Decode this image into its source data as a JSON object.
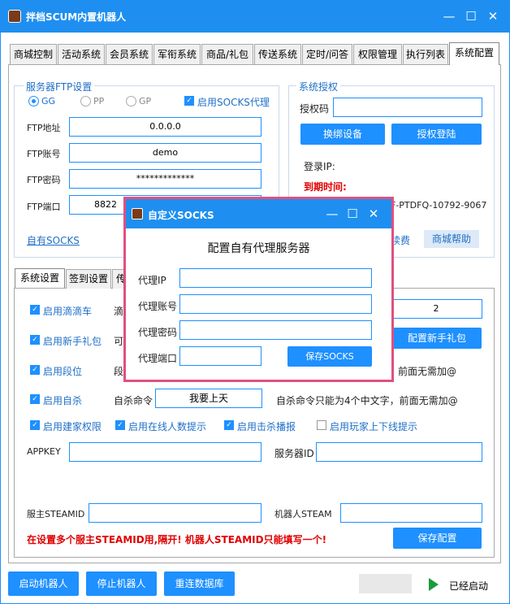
{
  "window": {
    "title": "拌档SCUM内置机器人",
    "controls": {
      "minimize": "—",
      "maximize": "☐",
      "close": "✕"
    }
  },
  "tabs": [
    {
      "label": "商城控制"
    },
    {
      "label": "活动系统"
    },
    {
      "label": "会员系统"
    },
    {
      "label": "军衔系统"
    },
    {
      "label": "商品/礼包"
    },
    {
      "label": "传送系统"
    },
    {
      "label": "定时/问答"
    },
    {
      "label": "权限管理"
    },
    {
      "label": "执行列表"
    },
    {
      "label": "系统配置",
      "active": true
    }
  ],
  "ftp": {
    "group_title": "服务器FTP设置",
    "radios": [
      {
        "label": "GG",
        "selected": true
      },
      {
        "label": "PP",
        "selected": false
      },
      {
        "label": "GP",
        "selected": false
      }
    ],
    "socks_checkbox_label": "启用SOCKS代理",
    "fields": [
      {
        "label": "FTP地址",
        "value": "0.0.0.0"
      },
      {
        "label": "FTP账号",
        "value": "demo"
      },
      {
        "label": "FTP密码",
        "value": "*************"
      },
      {
        "label": "FTP端口",
        "value": "8822"
      }
    ],
    "own_socks_link": "自有SOCKS"
  },
  "license": {
    "group_title": "系统授权",
    "code_label": "授权码",
    "code_value": "",
    "change_device_button": "换绑设备",
    "login_button": "授权登陆",
    "login_ip_label": "登录IP:",
    "expire_label": "到期时间:",
    "device_id_partial": "F-PTDFQ-10792-9067",
    "renew_link_partial": "续费",
    "mall_help_button": "商城帮助"
  },
  "subtabs": [
    {
      "label": "系统设置",
      "active": true
    },
    {
      "label": "签到设置"
    },
    {
      "label": "传"
    }
  ],
  "system": {
    "taxi_checkbox": "启用滴滴车",
    "taxi_cmd_partial": "滴",
    "taxi_value": "2",
    "newbie_checkbox": "启用新手礼包",
    "newbie_partial": "可",
    "newbie_config_button": "配置新手礼包",
    "rank_checkbox": "启用段位",
    "rank_partial": "段",
    "rank_hint_partial": "前面无需加@",
    "suicide_checkbox": "启用自杀",
    "suicide_cmd_label": "自杀命令",
    "suicide_cmd_value": "我要上天",
    "suicide_hint": "自杀命令只能为4个中文字，前面无需加@",
    "build_perm_checkbox": "启用建家权限",
    "online_count_checkbox": "启用在线人数提示",
    "kill_broadcast_checkbox": "启用击杀播报",
    "player_online_checkbox": "启用玩家上下线提示",
    "appkey_label": "APPKEY",
    "appkey_value": "",
    "server_id_label": "服务器ID",
    "server_id_value": "",
    "owner_steamid_label": "服主STEAMID",
    "owner_steamid_value": "",
    "bot_steam_label": "机器人STEAM",
    "bot_steam_value": "",
    "warning": "在设置多个服主STEAMID用,隔开! 机器人STEAMID只能填写一个!",
    "save_config_button": "保存配置"
  },
  "bottom": {
    "start_button": "启动机器人",
    "stop_button": "停止机器人",
    "reconnect_button": "重连数据库",
    "status_text": "已经启动"
  },
  "dialog": {
    "title": "自定义SOCKS",
    "heading": "配置自有代理服务器",
    "fields": [
      {
        "label": "代理IP",
        "value": ""
      },
      {
        "label": "代理账号",
        "value": ""
      },
      {
        "label": "代理密码",
        "value": ""
      },
      {
        "label": "代理端口",
        "value": ""
      }
    ],
    "save_button": "保存SOCKS",
    "controls": {
      "minimize": "—",
      "maximize": "☐",
      "close": "✕"
    }
  },
  "colors": {
    "accent": "#1e90ff",
    "dialog_border": "#e05080",
    "warning": "#e00000"
  }
}
